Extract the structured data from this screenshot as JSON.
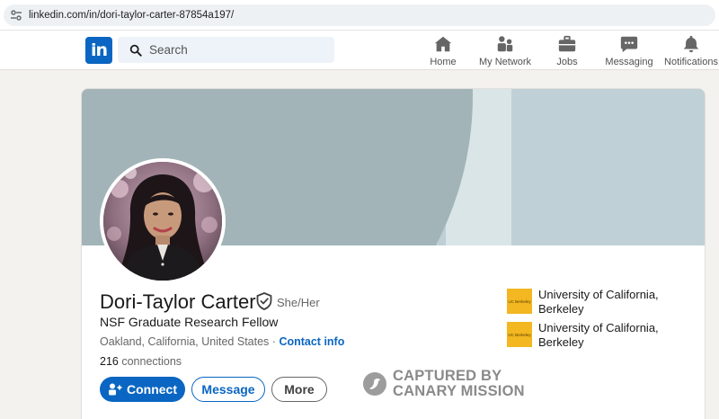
{
  "browser": {
    "url": "linkedin.com/in/dori-taylor-carter-87854a197/"
  },
  "nav": {
    "logo": "in",
    "search_placeholder": "Search",
    "items": [
      {
        "label": "Home",
        "icon": "home-icon"
      },
      {
        "label": "My Network",
        "icon": "network-icon"
      },
      {
        "label": "Jobs",
        "icon": "briefcase-icon"
      },
      {
        "label": "Messaging",
        "icon": "message-icon"
      },
      {
        "label": "Notifications",
        "icon": "bell-icon"
      }
    ]
  },
  "profile": {
    "name": "Dori-Taylor Carter",
    "pronouns": "She/Her",
    "headline": "NSF Graduate Research Fellow",
    "location": "Oakland, California, United States",
    "separator": "·",
    "contact_info": "Contact info",
    "connections_count": "216",
    "connections_label": "connections"
  },
  "actions": {
    "connect": "Connect",
    "message": "Message",
    "more": "More"
  },
  "education": [
    {
      "school": "University of California, Berkeley",
      "logo_text": "UC Berkeley"
    },
    {
      "school": "University of California, Berkeley",
      "logo_text": "UC Berkeley"
    }
  ],
  "watermark": {
    "line1": "CAPTURED BY",
    "line2": "CANARY MISSION"
  },
  "colors": {
    "brand": "#0a66c2",
    "berkeley_gold": "#f2b721"
  }
}
